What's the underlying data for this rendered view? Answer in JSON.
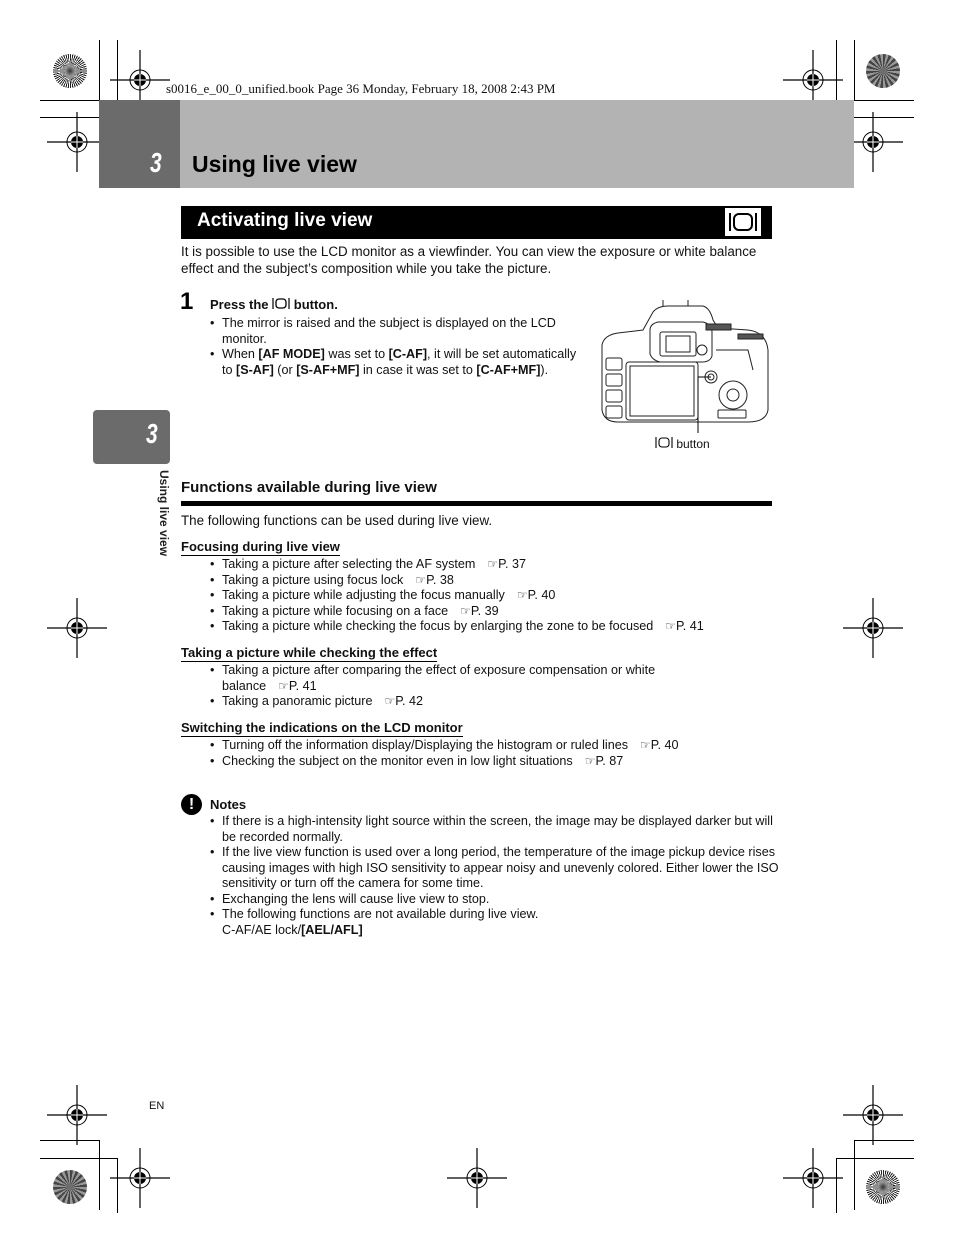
{
  "print_header": "s0016_e_00_0_unified.book  Page 36  Monday, February 18, 2008  2:43 PM",
  "chapter": {
    "number": "3",
    "title": "Using live view",
    "side_tab_number": "3",
    "side_tab_text": "Using live view"
  },
  "section": {
    "title": "Activating live view",
    "icon": "live-view-icon",
    "intro": "It is possible to use the LCD monitor as a viewfinder. You can view the exposure or white balance effect and the subject’s composition while you take the picture."
  },
  "step1": {
    "number": "1",
    "title_before": "Press the ",
    "title_after": " button.",
    "bullets": [
      {
        "text": "The mirror is raised and the subject is displayed on the LCD monitor."
      },
      {
        "parts": [
          "When ",
          "[AF MODE]",
          " was set to ",
          "[C-AF]",
          ", it will be set automatically to ",
          "[S-AF]",
          " (or ",
          "[S-AF+MF]",
          " in case it was set to ",
          "[C-AF+MF]",
          ")."
        ]
      }
    ],
    "figure_caption": " button"
  },
  "functions": {
    "heading": "Functions available during live view",
    "intro": "The following functions can be used during live view.",
    "groups": [
      {
        "title": "Focusing during live view",
        "items": [
          {
            "text": "Taking a picture after selecting the AF system",
            "ref": "P. 37"
          },
          {
            "text": "Taking a picture using focus lock",
            "ref": "P. 38"
          },
          {
            "text": "Taking a picture while adjusting the focus manually",
            "ref": "P. 40"
          },
          {
            "text": "Taking a picture while focusing on a face",
            "ref": "P. 39"
          },
          {
            "text": "Taking a picture while checking the focus by enlarging the zone to be focused",
            "ref": "P. 41"
          }
        ]
      },
      {
        "title": "Taking a picture while checking the effect",
        "items": [
          {
            "text": "Taking a picture after comparing the effect of exposure compensation or white balance",
            "ref": "P. 41"
          },
          {
            "text": "Taking a panoramic picture",
            "ref": "P. 42"
          }
        ]
      },
      {
        "title": "Switching the indications on the LCD monitor",
        "items": [
          {
            "text": "Turning off the information display/Displaying the histogram or ruled lines",
            "ref": "P. 40"
          },
          {
            "text": "Checking the subject on the monitor even in low light situations",
            "ref": "P. 87"
          }
        ]
      }
    ]
  },
  "notes": {
    "title": "Notes",
    "items": [
      "If there is a high-intensity light source within the screen, the image may be displayed darker but will be recorded normally.",
      "If the live view function is used over a long period, the temperature of the image pickup device rises causing images with high ISO sensitivity to appear noisy and unevenly colored. Either lower the ISO sensitivity or turn off the camera for some time.",
      "Exchanging the lens will cause live view to stop.",
      "The following functions are not available during live view."
    ],
    "last_line_plain": "C-AF/AE lock/",
    "last_line_bold": "[AEL/AFL]"
  },
  "footer": {
    "language": "EN"
  }
}
